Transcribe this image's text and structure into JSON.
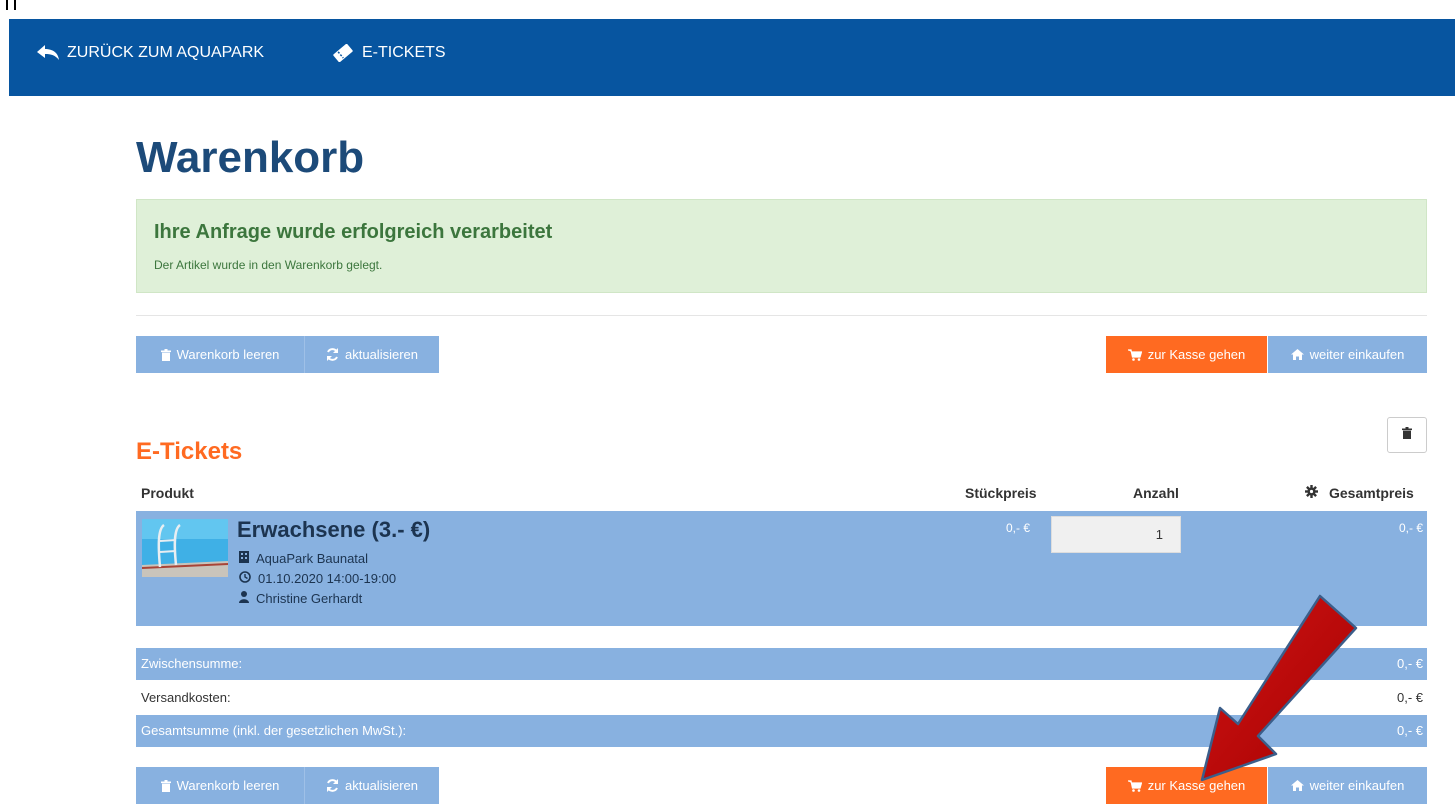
{
  "nav": {
    "back_label": "ZURÜCK ZUM AQUAPARK",
    "tickets_label": "E-TICKETS"
  },
  "page": {
    "title": "Warenkorb"
  },
  "alert": {
    "title": "Ihre Anfrage wurde erfolgreich verarbeitet",
    "text": "Der Artikel wurde in den Warenkorb gelegt."
  },
  "actions": {
    "empty_cart": "Warenkorb leeren",
    "refresh": "aktualisieren",
    "checkout": "zur Kasse gehen",
    "continue_shopping": "weiter einkaufen"
  },
  "section": {
    "title": "E-Tickets"
  },
  "table": {
    "headers": {
      "product": "Produkt",
      "unit_price": "Stückpreis",
      "quantity": "Anzahl",
      "total_price": "Gesamtpreis"
    }
  },
  "item": {
    "name": "Erwachsene (3.- €)",
    "location": "AquaPark Baunatal",
    "datetime": "01.10.2020 14:00-19:00",
    "person": "Christine Gerhardt",
    "unit_price": "0,- €",
    "quantity": "1",
    "total_price": "0,- €"
  },
  "summary": {
    "subtotal_label": "Zwischensumme:",
    "subtotal_value": "0,- €",
    "shipping_label": "Versandkosten:",
    "shipping_value": "0,- €",
    "grand_total_label": "Gesamtsumme (inkl. der gesetzlichen MwSt.):",
    "grand_total_value": "0,- €"
  },
  "colors": {
    "nav_bg": "#0755a0",
    "title": "#1c4a79",
    "accent_orange": "#ff6a21",
    "button_blue": "#88b1e0",
    "alert_bg": "#dff0d8",
    "alert_text": "#3c763d",
    "annotation_arrow": "#c00000"
  },
  "icons": {
    "back": "reply-arrow-icon",
    "tickets": "ticket-icon",
    "trash": "trash-icon",
    "refresh": "refresh-icon",
    "cart": "cart-icon",
    "home": "home-icon",
    "gear": "gear-icon",
    "building": "building-icon",
    "clock": "clock-icon",
    "user": "user-icon"
  }
}
